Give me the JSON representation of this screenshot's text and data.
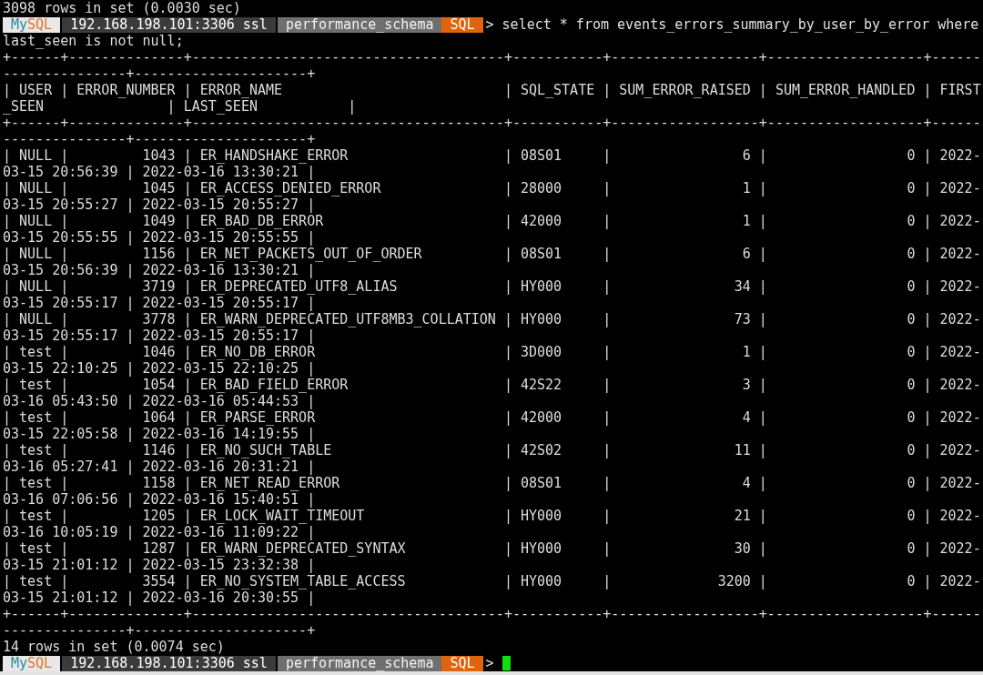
{
  "terminal": {
    "lines": [
      {
        "kind": "output",
        "text": "3098 rows in set (0.0030 sec)"
      },
      {
        "kind": "prompt",
        "logo": [
          {
            "text": "My",
            "color": "#2a8c9c"
          },
          {
            "text": "SQL",
            "color": "#e0742a"
          }
        ],
        "host": "192.168.198.101:3306 ssl",
        "schema": "performance_schema",
        "mode": "SQL",
        "symbol": ">",
        "command": "select * from events_errors_summary_by_user_by_error where"
      },
      {
        "kind": "output",
        "text": "last_seen is not null;"
      },
      {
        "kind": "output",
        "text": "+------+--------------+--------------------------------------+-----------+------------------+-------------------+------"
      },
      {
        "kind": "output",
        "text": "---------------+---------------------+"
      },
      {
        "kind": "output",
        "text": "| USER | ERROR_NUMBER | ERROR_NAME                           | SQL_STATE | SUM_ERROR_RAISED | SUM_ERROR_HANDLED | FIRST"
      },
      {
        "kind": "output",
        "text": "_SEEN               | LAST_SEEN           |"
      },
      {
        "kind": "output",
        "text": "+------+--------------+--------------------------------------+-----------+------------------+-------------------+------"
      },
      {
        "kind": "output",
        "text": "---------------+---------------------+"
      },
      {
        "kind": "output",
        "text": "| NULL |         1043 | ER_HANDSHAKE_ERROR                   | 08S01     |                6 |                 0 | 2022-"
      },
      {
        "kind": "output",
        "text": "03-15 20:56:39 | 2022-03-16 13:30:21 |"
      },
      {
        "kind": "output",
        "text": "| NULL |         1045 | ER_ACCESS_DENIED_ERROR               | 28000     |                1 |                 0 | 2022-"
      },
      {
        "kind": "output",
        "text": "03-15 20:55:27 | 2022-03-15 20:55:27 |"
      },
      {
        "kind": "output",
        "text": "| NULL |         1049 | ER_BAD_DB_ERROR                      | 42000     |                1 |                 0 | 2022-"
      },
      {
        "kind": "output",
        "text": "03-15 20:55:55 | 2022-03-15 20:55:55 |"
      },
      {
        "kind": "output",
        "text": "| NULL |         1156 | ER_NET_PACKETS_OUT_OF_ORDER          | 08S01     |                6 |                 0 | 2022-"
      },
      {
        "kind": "output",
        "text": "03-15 20:56:39 | 2022-03-16 13:30:21 |"
      },
      {
        "kind": "output",
        "text": "| NULL |         3719 | ER_DEPRECATED_UTF8_ALIAS             | HY000     |               34 |                 0 | 2022-"
      },
      {
        "kind": "output",
        "text": "03-15 20:55:17 | 2022-03-15 20:55:17 |"
      },
      {
        "kind": "output",
        "text": "| NULL |         3778 | ER_WARN_DEPRECATED_UTF8MB3_COLLATION | HY000     |               73 |                 0 | 2022-"
      },
      {
        "kind": "output",
        "text": "03-15 20:55:17 | 2022-03-15 20:55:17 |"
      },
      {
        "kind": "output",
        "text": "| test |         1046 | ER_NO_DB_ERROR                       | 3D000     |                1 |                 0 | 2022-"
      },
      {
        "kind": "output",
        "text": "03-15 22:10:25 | 2022-03-15 22:10:25 |"
      },
      {
        "kind": "output",
        "text": "| test |         1054 | ER_BAD_FIELD_ERROR                   | 42S22     |                3 |                 0 | 2022-"
      },
      {
        "kind": "output",
        "text": "03-16 05:43:50 | 2022-03-16 05:44:53 |"
      },
      {
        "kind": "output",
        "text": "| test |         1064 | ER_PARSE_ERROR                       | 42000     |                4 |                 0 | 2022-"
      },
      {
        "kind": "output",
        "text": "03-15 22:05:58 | 2022-03-16 14:19:55 |"
      },
      {
        "kind": "output",
        "text": "| test |         1146 | ER_NO_SUCH_TABLE                     | 42S02     |               11 |                 0 | 2022-"
      },
      {
        "kind": "output",
        "text": "03-16 05:27:41 | 2022-03-16 20:31:21 |"
      },
      {
        "kind": "output",
        "text": "| test |         1158 | ER_NET_READ_ERROR                    | 08S01     |                4 |                 0 | 2022-"
      },
      {
        "kind": "output",
        "text": "03-16 07:06:56 | 2022-03-16 15:40:51 |"
      },
      {
        "kind": "output",
        "text": "| test |         1205 | ER_LOCK_WAIT_TIMEOUT                 | HY000     |               21 |                 0 | 2022-"
      },
      {
        "kind": "output",
        "text": "03-16 10:05:19 | 2022-03-16 11:09:22 |"
      },
      {
        "kind": "output",
        "text": "| test |         1287 | ER_WARN_DEPRECATED_SYNTAX            | HY000     |               30 |                 0 | 2022-"
      },
      {
        "kind": "output",
        "text": "03-15 21:01:12 | 2022-03-15 23:32:38 |"
      },
      {
        "kind": "output",
        "text": "| test |         3554 | ER_NO_SYSTEM_TABLE_ACCESS            | HY000     |             3200 |                 0 | 2022-"
      },
      {
        "kind": "output",
        "text": "03-15 21:01:12 | 2022-03-16 20:30:55 |"
      },
      {
        "kind": "output",
        "text": "+------+--------------+--------------------------------------+-----------+------------------+-------------------+------"
      },
      {
        "kind": "output",
        "text": "---------------+---------------------+"
      },
      {
        "kind": "output",
        "text": "14 rows in set (0.0074 sec)"
      },
      {
        "kind": "prompt",
        "logo": [
          {
            "text": "My",
            "color": "#2a8c9c"
          },
          {
            "text": "SQL",
            "color": "#e0742a"
          }
        ],
        "host": "192.168.198.101:3306 ssl",
        "schema": "performance_schema",
        "mode": "SQL",
        "symbol": ">",
        "cursor": true
      }
    ]
  }
}
